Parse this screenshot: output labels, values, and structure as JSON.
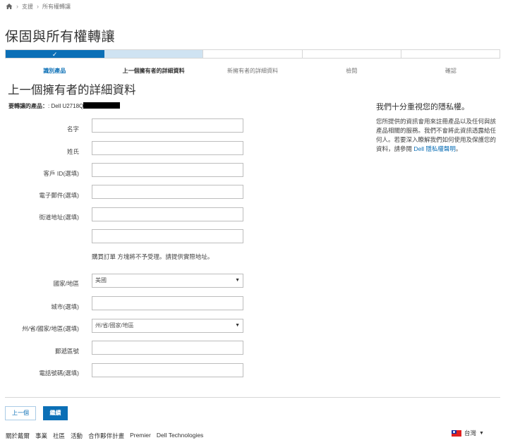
{
  "breadcrumb": {
    "items": [
      "支援",
      "所有權轉讓"
    ]
  },
  "page_title": "保固與所有權轉讓",
  "progress": {
    "steps": [
      "識別產品",
      "上一個擁有者的詳細資料",
      "新擁有者的詳細資料",
      "檢閱",
      "確認"
    ],
    "completed": 1,
    "current": 2
  },
  "section_title": "上一個擁有者的詳細資料",
  "product": {
    "label": "要轉讓的產品：",
    "value": ": Dell U2718Q"
  },
  "form": {
    "first_name_label": "名字",
    "last_name_label": "姓氏",
    "customer_id_label": "客戶 ID(選填)",
    "email_label": "電子郵件(選填)",
    "street_label": "街道地址(選填)",
    "address_note": "購買訂單 方塊將不予受理。請提供實際地址。",
    "country_label": "國家/地區",
    "country_value": "美國",
    "city_label": "城市(選填)",
    "state_label": "州/省/國家/地區(選填)",
    "state_value": "州/省/國家/地區",
    "zip_label": "郵遞區號",
    "phone_label": "電話號碼(選填)"
  },
  "privacy": {
    "title": "我們十分重視您的隱私權。",
    "body": "您所提供的資訊會用來註冊產品以及任何與該產品相關的服務。我們不會將此資訊透露給任何人。若要深入瞭解我們如何使用及保護您的資料，請參閱 ",
    "link": "Dell 隱私權聲明",
    "end": "。"
  },
  "buttons": {
    "back": "上一個",
    "next": "繼續"
  },
  "footer": {
    "links": [
      "關於戴爾",
      "事業",
      "社區",
      "活動",
      "合作夥伴計畫",
      "Premier",
      "Dell Technologies"
    ]
  },
  "country_selector": {
    "label": "台灣",
    "icon": "taiwan-flag-icon"
  },
  "colors": {
    "accent": "#0b6fb6",
    "current_step": "#cfe3f2"
  }
}
